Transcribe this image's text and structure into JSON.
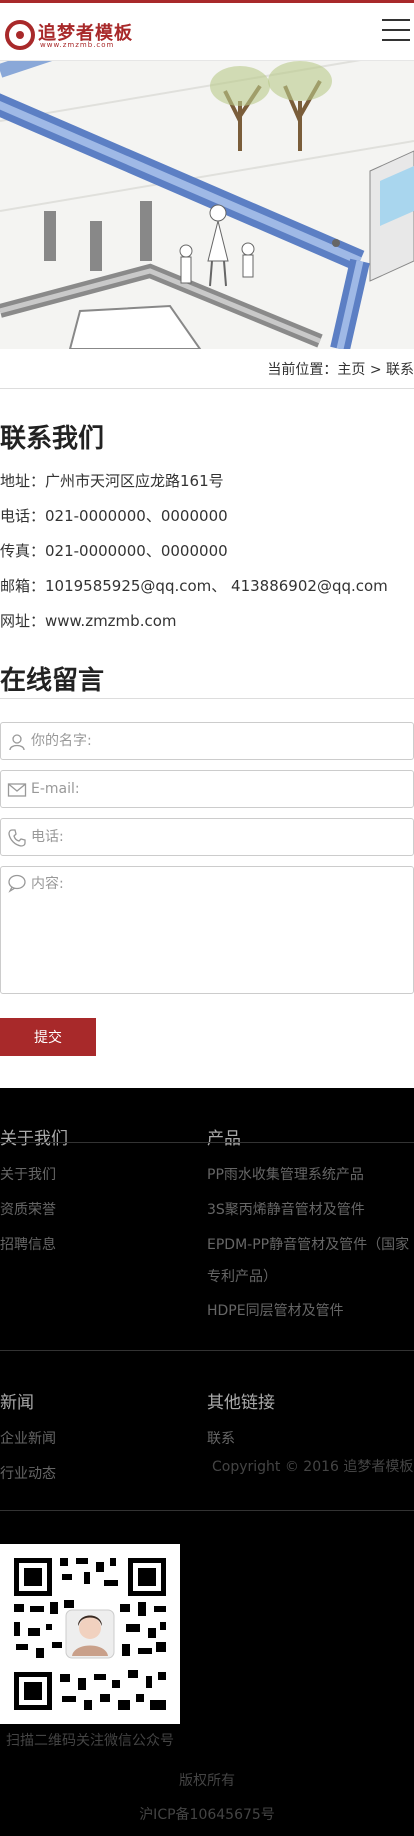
{
  "brand": {
    "name": "追梦者模板",
    "domain": "www.zmzmb.com",
    "accent": "#a8292a"
  },
  "header": {
    "menu_icon": "hamburger-menu-icon"
  },
  "breadcrumb": {
    "prefix": "当前位置：",
    "home": "主页",
    "separator": ">",
    "current": "联系"
  },
  "contact": {
    "title": "联系我们",
    "address": "地址：广州市天河区应龙路161号",
    "phone": "电话：021-0000000、0000000",
    "fax": "传真：021-0000000、0000000",
    "email": "邮箱：1019585925@qq.com、 413886902@qq.com",
    "website": "网址：www.zmzmb.com"
  },
  "form": {
    "title": "在线留言",
    "name_placeholder": "你的名字:",
    "email_placeholder": "E-mail:",
    "phone_placeholder": "电话:",
    "content_placeholder": "内容:",
    "submit_label": "提交"
  },
  "footer": {
    "about": {
      "title": "关于我们",
      "items": [
        "关于我们",
        "资质荣誉",
        "招聘信息"
      ]
    },
    "products": {
      "title": "产品",
      "items": [
        "PP雨水收集管理系统产品",
        "3S聚丙烯静音管材及管件",
        "EPDM-PP静音管材及管件（国家",
        "专利产品）",
        "HDPE同层管材及管件"
      ]
    },
    "news": {
      "title": "新闻",
      "items": [
        "企业新闻",
        "行业动态"
      ]
    },
    "links": {
      "title": "其他链接",
      "items": [
        "联系"
      ]
    },
    "copyright": "Copyright © 2016 追梦者模板",
    "qr_caption": "扫描二维码关注微信公众号",
    "rights": "版权所有",
    "icp": "沪ICP备10645675号"
  }
}
